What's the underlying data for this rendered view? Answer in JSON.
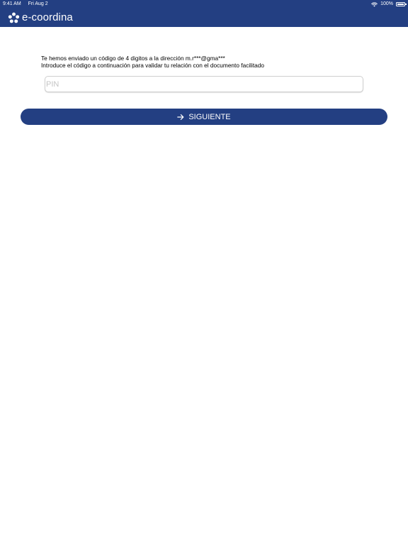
{
  "status_bar": {
    "time": "9:41 AM",
    "date": "Fri Aug 2",
    "battery": "100%",
    "icons": [
      "wifi-icon",
      "battery-icon"
    ]
  },
  "header": {
    "logo_text": "e-coordina",
    "logo_icon": "flower-logo-icon",
    "background_color": "#233f82"
  },
  "message": {
    "line1": "Te hemos enviado un código de 4 digitos a la dirección m.r***@gma***",
    "line2": "Introduce el código a continuación para validar tu relación con el documento facilitado"
  },
  "pin": {
    "placeholder": "PIN",
    "value": ""
  },
  "next_button": {
    "label": "SIGUIENTE",
    "icon": "arrow-right-icon",
    "color": "#233f82"
  }
}
